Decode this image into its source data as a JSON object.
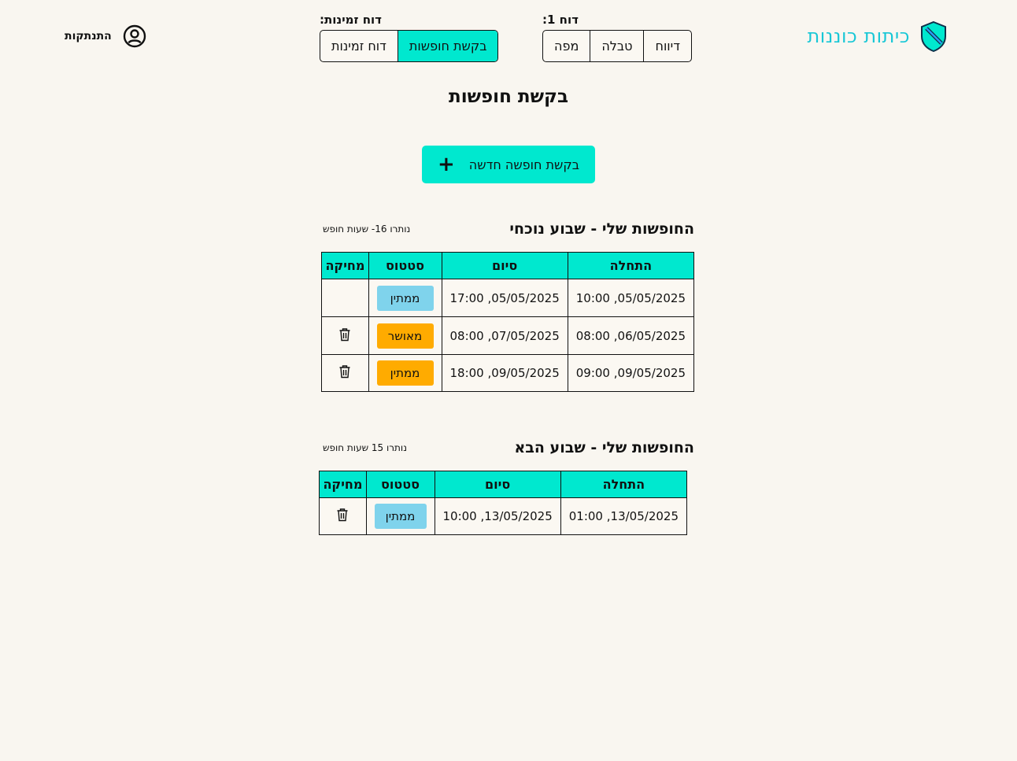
{
  "app": {
    "title": "כיתות כוננות"
  },
  "header": {
    "report1": {
      "label": "דוח 1:",
      "buttons": [
        "דיווח",
        "טבלה",
        "מפה"
      ]
    },
    "availability": {
      "label": "דוח זמינות:",
      "buttons": [
        "בקשת חופשות",
        "דוח זמינות"
      ],
      "active": "בקשת חופשות"
    },
    "logout": "התנתקות"
  },
  "page": {
    "title": "בקשת חופשות",
    "new_request": "בקשת חופשה חדשה"
  },
  "columns": [
    "התחלה",
    "סיום",
    "סטטוס",
    "מחיקה"
  ],
  "sections": [
    {
      "title": "החופשות שלי - שבוע נוכחי",
      "remaining": "נותרו 16- שעות חופש",
      "rows": [
        {
          "start": "05/05/2025, 10:00",
          "end": "05/05/2025, 17:00",
          "status": "ממתין",
          "status_type": "pending",
          "deletable": false
        },
        {
          "start": "06/05/2025, 08:00",
          "end": "07/05/2025, 08:00",
          "status": "מאושר",
          "status_type": "approved",
          "deletable": true
        },
        {
          "start": "09/05/2025, 09:00",
          "end": "09/05/2025, 18:00",
          "status": "ממתין",
          "status_type": "approved",
          "deletable": true
        }
      ]
    },
    {
      "title": "החופשות שלי - שבוע הבא",
      "remaining": "נותרו 15 שעות חופש",
      "rows": [
        {
          "start": "13/05/2025, 01:00",
          "end": "13/05/2025, 10:00",
          "status": "ממתין",
          "status_type": "pending",
          "deletable": true
        }
      ]
    }
  ],
  "colors": {
    "accent": "#00e8cf",
    "logo": "#18c7d6",
    "pending": "#7fd3ec",
    "approved": "#ffab00",
    "background": "#f9f6f0"
  },
  "icons": {
    "logo": "shield-icon",
    "logout": "user-circle-icon",
    "add": "plus-icon",
    "delete": "trash-icon"
  }
}
